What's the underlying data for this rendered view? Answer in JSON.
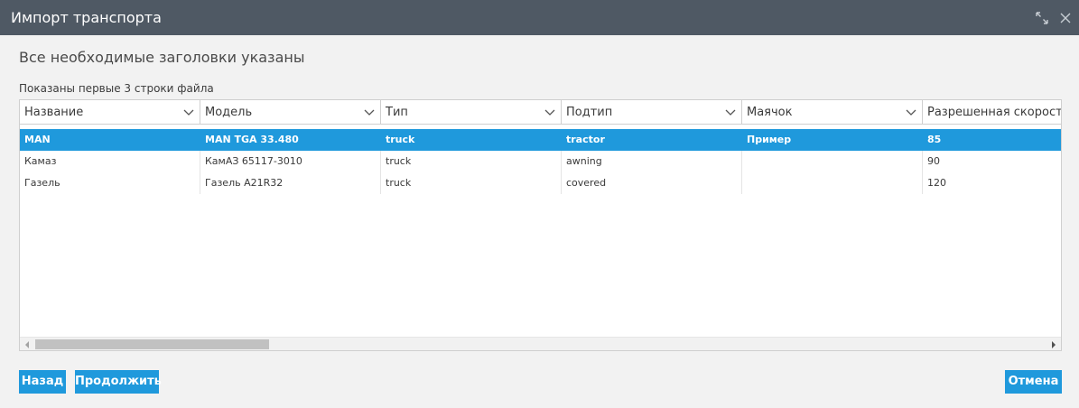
{
  "window": {
    "title": "Импорт транспорта",
    "icons": [
      "expand-icon",
      "close-icon"
    ]
  },
  "status_text": "Все необходимые заголовки указаны",
  "preview_note": "Показаны первые 3 строки файла",
  "grid": {
    "columns": [
      "Название",
      "Модель",
      "Тип",
      "Подтип",
      "Маячок",
      "Разрешенная скорость"
    ],
    "rows": [
      [
        "MAN",
        "MAN TGA 33.480",
        "truck",
        "tractor",
        "Пример",
        "85"
      ],
      [
        "Камаз",
        "КамАЗ 65117-3010",
        "truck",
        "awning",
        "",
        "90"
      ],
      [
        "Газель",
        "Газель А21R32",
        "truck",
        "covered",
        "",
        "120"
      ]
    ],
    "selected_row": 0
  },
  "buttons": {
    "back": "Назад",
    "continue": "Продолжить",
    "cancel": "Отмена"
  },
  "colors": {
    "titlebar": "#4f5964",
    "accent": "#1f99dc",
    "background": "#f2f2f2"
  }
}
